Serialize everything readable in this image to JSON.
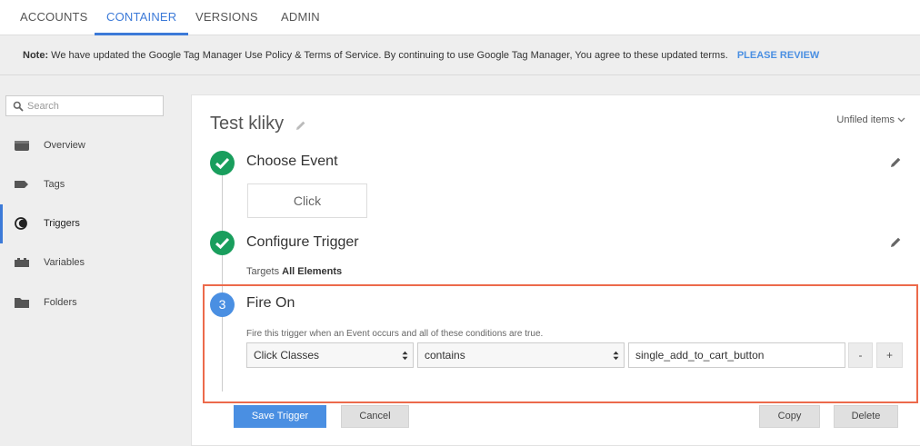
{
  "topnav": {
    "tabs": [
      {
        "label": "ACCOUNTS"
      },
      {
        "label": "CONTAINER"
      },
      {
        "label": "VERSIONS"
      },
      {
        "label": "ADMIN"
      }
    ],
    "active_tab": "CONTAINER"
  },
  "notice": {
    "label": "Note:",
    "text": "We have updated the Google Tag Manager Use Policy & Terms of Service. By continuing to use Google Tag Manager, You agree to these updated terms.",
    "link": "PLEASE REVIEW"
  },
  "sidebar": {
    "search_placeholder": "Search",
    "items": [
      {
        "label": "Overview",
        "icon": "overview-icon"
      },
      {
        "label": "Tags",
        "icon": "tag-icon"
      },
      {
        "label": "Triggers",
        "icon": "trigger-icon"
      },
      {
        "label": "Variables",
        "icon": "variable-icon"
      },
      {
        "label": "Folders",
        "icon": "folder-icon"
      }
    ],
    "active_item": "Triggers"
  },
  "trigger": {
    "name": "Test kliky",
    "folder": "Unfiled items",
    "step1": {
      "title": "Choose Event",
      "event": "Click"
    },
    "step2": {
      "title": "Configure Trigger",
      "targets_label": "Targets",
      "targets_value": "All Elements"
    },
    "step3": {
      "number": "3",
      "title": "Fire On",
      "description": "Fire this trigger when an Event occurs and all of these conditions are true.",
      "condition": {
        "variable": "Click Classes",
        "operator": "contains",
        "value": "single_add_to_cart_button"
      },
      "remove_label": "-",
      "add_label": "+"
    }
  },
  "actions": {
    "save": "Save Trigger",
    "cancel": "Cancel",
    "copy": "Copy",
    "delete": "Delete"
  },
  "colors": {
    "accent": "#3c7ad8",
    "button_primary": "#4a8fe2",
    "check_green": "#199e5d",
    "highlight": "#ec6a4b"
  }
}
